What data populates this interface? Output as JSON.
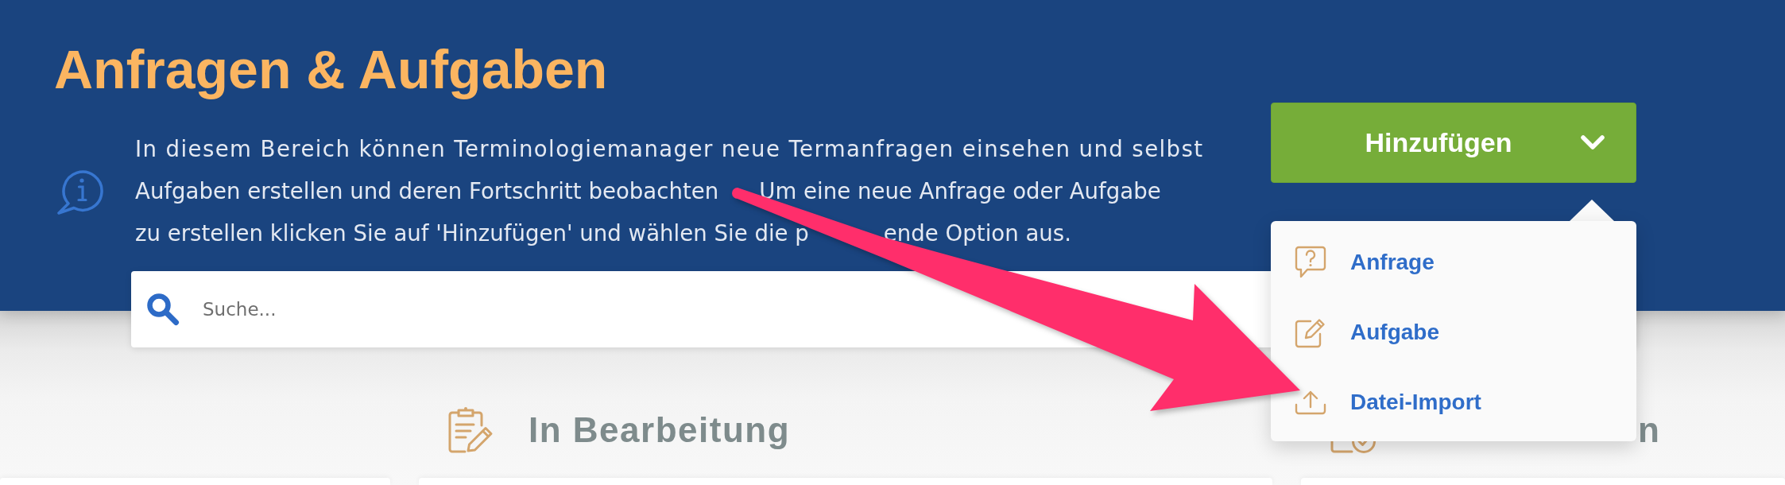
{
  "header": {
    "title": "Anfragen & Aufgaben",
    "info_text": {
      "lines": [
        [
          "In diesem Bereich können Terminologiemanager neue Termanfragen einsehen und selbst"
        ],
        [
          "Aufgaben erstellen und deren Fortschritt beobachten",
          "Um eine neue Anfrage oder Aufgabe"
        ],
        [
          "zu erstellen klicken Sie auf 'Hinzufügen' und wählen Sie die p",
          "ende Option aus."
        ]
      ]
    }
  },
  "add_button": {
    "label": "Hinzufügen",
    "expanded": true
  },
  "add_menu": {
    "items": [
      {
        "label": "Anfrage"
      },
      {
        "label": "Aufgabe"
      },
      {
        "label": "Datei-Import"
      }
    ]
  },
  "search": {
    "placeholder": "Suche..."
  },
  "columns": [
    {
      "kind": "blank"
    },
    {
      "kind": "titled",
      "heading": "In Bearbeitung"
    },
    {
      "kind": "covered",
      "heading": "n"
    }
  ]
}
